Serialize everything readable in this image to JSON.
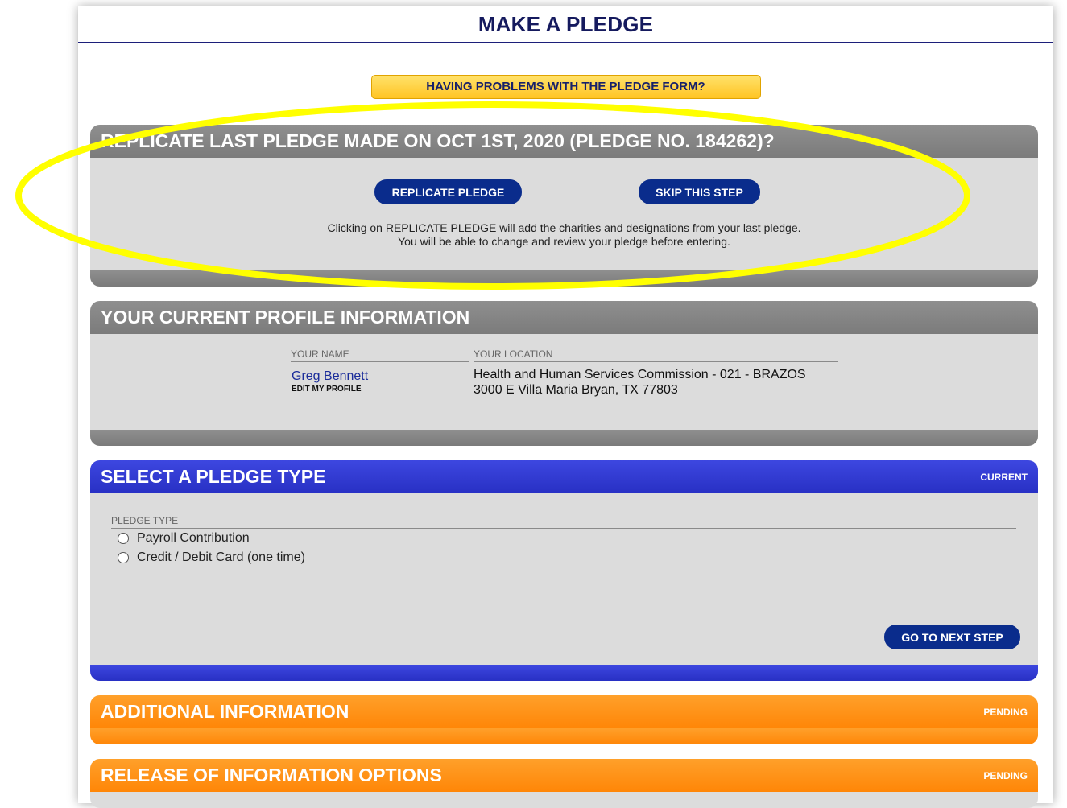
{
  "header": {
    "title": "MAKE A PLEDGE"
  },
  "help_button_label": "HAVING PROBLEMS WITH THE PLEDGE FORM?",
  "replicate": {
    "title": "REPLICATE LAST PLEDGE MADE ON OCT 1ST, 2020 (PLEDGE NO. 184262)?",
    "replicate_button": "REPLICATE PLEDGE",
    "skip_button": "SKIP THIS STEP",
    "note_line1": "Clicking on REPLICATE PLEDGE will add the charities and designations from your last pledge.",
    "note_line2": "You will be able to change and review your pledge before entering."
  },
  "profile": {
    "title": "YOUR CURRENT PROFILE INFORMATION",
    "name_label": "YOUR NAME",
    "name_value": "Greg Bennett",
    "edit_link": "EDIT MY PROFILE",
    "location_label": "YOUR LOCATION",
    "location_line1": "Health and Human Services Commission - 021 - BRAZOS",
    "location_line2": "3000 E Villa Maria Bryan, TX 77803"
  },
  "pledge_type": {
    "title": "SELECT A PLEDGE TYPE",
    "status": "CURRENT",
    "field_label": "PLEDGE TYPE",
    "options": [
      "Payroll Contribution",
      "Credit / Debit Card (one time)"
    ],
    "next_button": "GO TO NEXT STEP"
  },
  "additional": {
    "title": "ADDITIONAL INFORMATION",
    "status": "PENDING"
  },
  "release": {
    "title": "RELEASE OF INFORMATION OPTIONS",
    "status": "PENDING"
  },
  "colors": {
    "gray_header": "#838383",
    "blue_header": "#2f38d0",
    "orange_header": "#ff8f12",
    "button_blue": "#0a2c8c",
    "help_yellow": "#ffd33d",
    "highlight": "#ffff00"
  }
}
